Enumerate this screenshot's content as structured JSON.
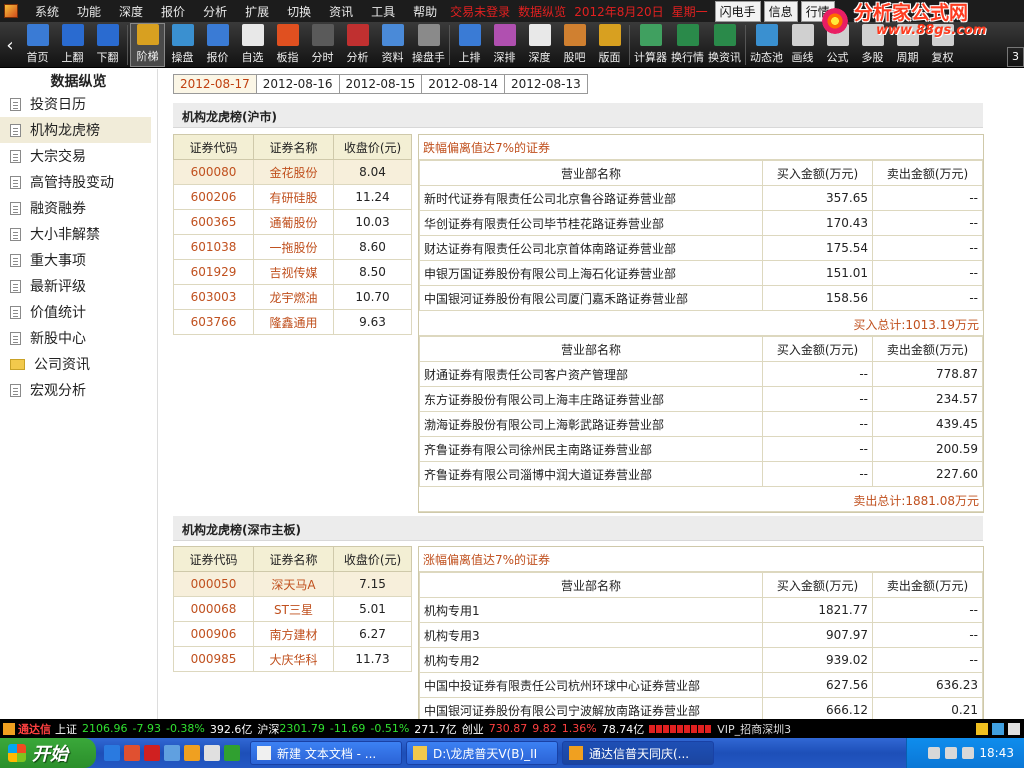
{
  "menubar": {
    "items": [
      "系统",
      "功能",
      "深度",
      "报价",
      "分析",
      "扩展",
      "切换",
      "资讯",
      "工具",
      "帮助"
    ],
    "status": [
      "交易未登录",
      "数据纵览",
      "2012年8月20日",
      "星期一"
    ],
    "right_buttons": [
      "闪电手",
      "信息",
      "行情"
    ]
  },
  "logo": {
    "name": "分析家公式网",
    "url": "www.88gs.com"
  },
  "toolbar": {
    "buttons": [
      {
        "label": "首页",
        "icon": "home-icon",
        "color": "#3a7bd5"
      },
      {
        "label": "上翻",
        "icon": "arrow-up-icon",
        "color": "#2a6bd0"
      },
      {
        "label": "下翻",
        "icon": "arrow-down-icon",
        "color": "#2a6bd0"
      },
      {
        "label": "阶梯",
        "icon": "ladder-icon",
        "color": "#d8a020"
      },
      {
        "label": "操盘",
        "icon": "trade-icon",
        "color": "#3a90d0"
      },
      {
        "label": "报价",
        "icon": "yen-icon",
        "color": "#3a7bd5"
      },
      {
        "label": "自选",
        "icon": "f6-icon",
        "color": "#e8e8e8"
      },
      {
        "label": "板指",
        "icon": "board-icon",
        "color": "#e05020"
      },
      {
        "label": "分时",
        "icon": "timeline-icon",
        "color": "#5a5a5a"
      },
      {
        "label": "分析",
        "icon": "analysis-icon",
        "color": "#c03030"
      },
      {
        "label": "资料",
        "icon": "document-icon",
        "color": "#4a8ad8"
      },
      {
        "label": "操盘手",
        "icon": "f10-icon",
        "color": "#8a8a8a"
      },
      {
        "label": "上排",
        "icon": "rank-up-icon",
        "color": "#3a7bd5"
      },
      {
        "label": "深排",
        "icon": "rank-deep-icon",
        "color": "#b050b0"
      },
      {
        "label": "深度",
        "icon": "f9-icon",
        "color": "#e8e8e8"
      },
      {
        "label": "股吧",
        "icon": "people-icon",
        "color": "#d08030"
      },
      {
        "label": "版面",
        "icon": "l2-icon",
        "color": "#d8a020"
      },
      {
        "label": "计算器",
        "icon": "calculator-icon",
        "color": "#40a060"
      },
      {
        "label": "换行情",
        "icon": "switch-quote-icon",
        "color": "#2a8a4a"
      },
      {
        "label": "换资讯",
        "icon": "switch-info-icon",
        "color": "#2a8a4a"
      },
      {
        "label": "动态池",
        "icon": "pool-icon",
        "color": "#3a90d0"
      },
      {
        "label": "画线",
        "icon": "draw-icon",
        "color": "#d0d0d0"
      },
      {
        "label": "公式",
        "icon": "formula-icon",
        "color": "#d0d0d0"
      },
      {
        "label": "多股",
        "icon": "multi-icon",
        "color": "#d0d0d0"
      },
      {
        "label": "周期",
        "icon": "period-icon",
        "color": "#d0d0d0"
      },
      {
        "label": "复权",
        "icon": "restore-icon",
        "color": "#d0d0d0"
      }
    ],
    "page_indicator": "3"
  },
  "sidebar": {
    "title": "数据纵览",
    "items": [
      {
        "label": "投资日历",
        "type": "doc"
      },
      {
        "label": "机构龙虎榜",
        "type": "doc",
        "active": true
      },
      {
        "label": "大宗交易",
        "type": "doc"
      },
      {
        "label": "高管持股变动",
        "type": "doc"
      },
      {
        "label": "融资融券",
        "type": "doc"
      },
      {
        "label": "大小非解禁",
        "type": "doc"
      },
      {
        "label": "重大事项",
        "type": "doc"
      },
      {
        "label": "最新评级",
        "type": "doc"
      },
      {
        "label": "价值统计",
        "type": "doc"
      },
      {
        "label": "新股中心",
        "type": "doc"
      },
      {
        "label": "公司资讯",
        "type": "folder"
      },
      {
        "label": "宏观分析",
        "type": "doc"
      }
    ]
  },
  "date_tabs": [
    "2012-08-17",
    "2012-08-16",
    "2012-08-15",
    "2012-08-14",
    "2012-08-13"
  ],
  "section_sh": {
    "title": "机构龙虎榜(沪市)",
    "stock_headers": [
      "证券代码",
      "证券名称",
      "收盘价(元)"
    ],
    "stocks": [
      [
        "600080",
        "金花股份",
        "8.04"
      ],
      [
        "600206",
        "有研硅股",
        "11.24"
      ],
      [
        "600365",
        "通葡股份",
        "10.03"
      ],
      [
        "601038",
        "一拖股份",
        "8.60"
      ],
      [
        "601929",
        "吉视传媒",
        "8.50"
      ],
      [
        "603003",
        "龙宇燃油",
        "10.70"
      ],
      [
        "603766",
        "隆鑫通用",
        "9.63"
      ]
    ],
    "box_title": "跌幅偏离值达7%的证券",
    "broker_headers": [
      "营业部名称",
      "买入金额(万元)",
      "卖出金额(万元)"
    ],
    "buy_rows": [
      [
        "新时代证券有限责任公司北京鲁谷路证券营业部",
        "357.65",
        "--"
      ],
      [
        "华创证券有限责任公司毕节桂花路证券营业部",
        "170.43",
        "--"
      ],
      [
        "财达证券有限责任公司北京首体南路证券营业部",
        "175.54",
        "--"
      ],
      [
        "申银万国证券股份有限公司上海石化证券营业部",
        "151.01",
        "--"
      ],
      [
        "中国银河证券股份有限公司厦门嘉禾路证券营业部",
        "158.56",
        "--"
      ]
    ],
    "buy_total": "买入总计:1013.19万元",
    "sell_rows": [
      [
        "财通证券有限责任公司客户资产管理部",
        "--",
        "778.87"
      ],
      [
        "东方证券股份有限公司上海丰庄路证券营业部",
        "--",
        "234.57"
      ],
      [
        "渤海证券股份有限公司上海彰武路证券营业部",
        "--",
        "439.45"
      ],
      [
        "齐鲁证券有限公司徐州民主南路证券营业部",
        "--",
        "200.59"
      ],
      [
        "齐鲁证券有限公司淄博中润大道证券营业部",
        "--",
        "227.60"
      ]
    ],
    "sell_total": "卖出总计:1881.08万元"
  },
  "section_sz": {
    "title": "机构龙虎榜(深市主板)",
    "stock_headers": [
      "证券代码",
      "证券名称",
      "收盘价(元)"
    ],
    "stocks": [
      [
        "000050",
        "深天马A",
        "7.15"
      ],
      [
        "000068",
        "ST三星",
        "5.01"
      ],
      [
        "000906",
        "南方建材",
        "6.27"
      ],
      [
        "000985",
        "大庆华科",
        "11.73"
      ]
    ],
    "box_title": "涨幅偏离值达7%的证券",
    "broker_headers": [
      "营业部名称",
      "买入金额(万元)",
      "卖出金额(万元)"
    ],
    "rows": [
      [
        "机构专用1",
        "1821.77",
        "--"
      ],
      [
        "机构专用3",
        "907.97",
        "--"
      ],
      [
        "机构专用2",
        "939.02",
        "--"
      ],
      [
        "中国中投证券有限责任公司杭州环球中心证券营业部",
        "627.56",
        "636.23"
      ],
      [
        "中国银河证券股份有限公司宁波解放南路证券营业部",
        "666.12",
        "0.21"
      ]
    ]
  },
  "statusbar": {
    "brand": "通达信",
    "sh_label": "上证",
    "sh_index": "2106.96",
    "sh_change": "-7.93",
    "sh_pct": "-0.38%",
    "sh_amount": "392.6亿",
    "sz_label": "沪深",
    "sz_index": "2301.79",
    "sz_change": "-11.69",
    "sz_pct": "-0.51%",
    "sz_amount": "271.7亿",
    "cy_label": "创业",
    "cy_index": "730.87",
    "cy_change": "9.82",
    "cy_pct": "1.36%",
    "cy_amount": "78.74亿",
    "vip": "VIP_招商深圳3"
  },
  "taskbar": {
    "start": "开始",
    "tasks": [
      "新建 文本文档 - ...",
      "D:\\龙虎普天V(B)_II",
      "通达信普天同庆(..."
    ],
    "clock": "18:43"
  }
}
